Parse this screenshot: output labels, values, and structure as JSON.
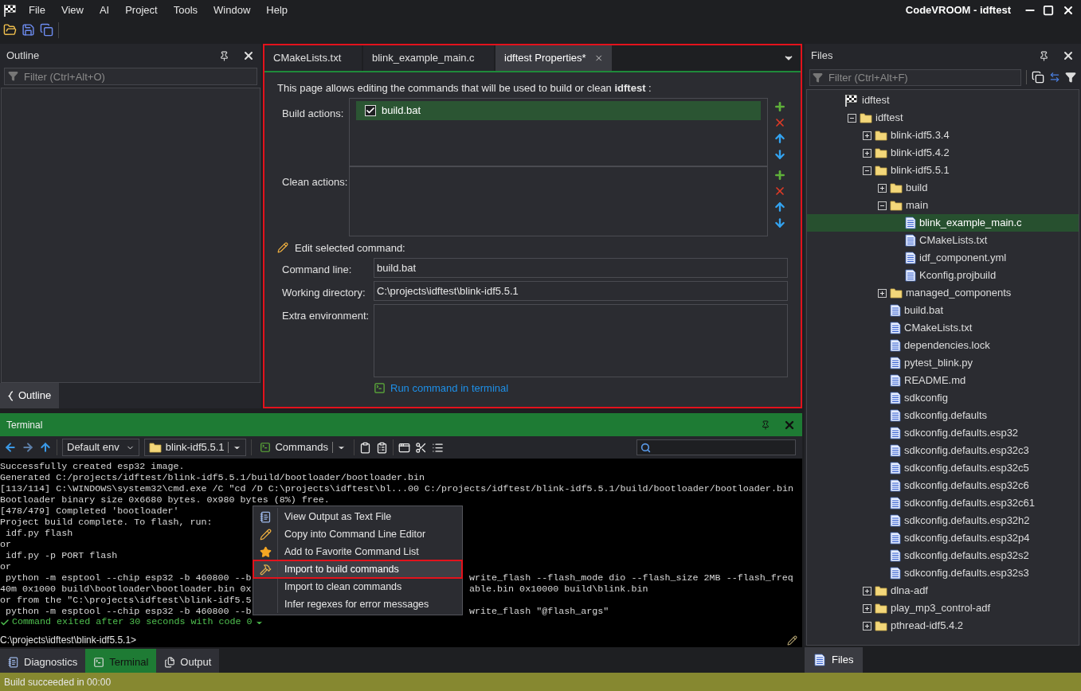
{
  "menu_bar": {
    "items": [
      "File",
      "View",
      "AI",
      "Project",
      "Tools",
      "Window",
      "Help"
    ],
    "title": "CodeVROOM - idftest"
  },
  "outline_panel": {
    "title": "Outline",
    "filter": {
      "placeholder": "Filter (Ctrl+Alt+O)"
    },
    "tabs": [
      {
        "label": "Outline",
        "selected": true
      }
    ]
  },
  "editor": {
    "tabs": [
      {
        "label": "CMakeLists.txt",
        "selected": false
      },
      {
        "label": "blink_example_main.c",
        "selected": false
      },
      {
        "label": "idftest Properties*",
        "selected": true
      }
    ],
    "intro": "This page allows editing the commands that will be used to build or clean **idftest** :",
    "build_actions": {
      "label": "Build actions:",
      "items": [
        {
          "label": "build.bat",
          "checked": true,
          "selected": true
        }
      ]
    },
    "clean_actions": {
      "label": "Clean actions:"
    },
    "edit_title": "Edit selected command:",
    "fields": [
      {
        "kind": "line",
        "label": "Command line:",
        "value": "build.bat"
      },
      {
        "kind": "line",
        "label": "Working directory:",
        "value": "C:\\projects\\idftest\\blink-idf5.5.1"
      },
      {
        "kind": "area",
        "label": "Extra environment:"
      }
    ],
    "run_link": "Run command in terminal"
  },
  "files_panel": {
    "title": "Files",
    "filter": {
      "placeholder": "Filter (Ctrl+Alt+F)"
    },
    "tree": [
      {
        "kind": "project",
        "label": "idftest",
        "selected": false,
        "children": [
          {
            "kind": "folder",
            "label": "idftest",
            "expanded": true,
            "selected": false,
            "children": [
              {
                "kind": "folder",
                "label": "blink-idf5.3.4",
                "expanded": false,
                "selected": false
              },
              {
                "kind": "folder",
                "label": "blink-idf5.4.2",
                "expanded": false,
                "selected": false
              },
              {
                "kind": "folder",
                "label": "blink-idf5.5.1",
                "expanded": true,
                "selected": false,
                "children": [
                  {
                    "kind": "folder",
                    "label": "build",
                    "expanded": false,
                    "selected": false
                  },
                  {
                    "kind": "folder",
                    "label": "main",
                    "expanded": true,
                    "selected": false,
                    "children": [
                      {
                        "kind": "file",
                        "label": "blink_example_main.c",
                        "selected": true
                      },
                      {
                        "kind": "file",
                        "label": "CMakeLists.txt",
                        "selected": false
                      },
                      {
                        "kind": "file",
                        "label": "idf_component.yml",
                        "selected": false
                      },
                      {
                        "kind": "file",
                        "label": "Kconfig.projbuild",
                        "selected": false
                      }
                    ]
                  },
                  {
                    "kind": "folder",
                    "label": "managed_components",
                    "expanded": false,
                    "selected": false
                  },
                  {
                    "kind": "file",
                    "label": "build.bat",
                    "selected": false
                  },
                  {
                    "kind": "file",
                    "label": "CMakeLists.txt",
                    "selected": false
                  },
                  {
                    "kind": "file",
                    "label": "dependencies.lock",
                    "selected": false
                  },
                  {
                    "kind": "file",
                    "label": "pytest_blink.py",
                    "selected": false
                  },
                  {
                    "kind": "file",
                    "label": "README.md",
                    "selected": false
                  },
                  {
                    "kind": "file",
                    "label": "sdkconfig",
                    "selected": false
                  },
                  {
                    "kind": "file",
                    "label": "sdkconfig.defaults",
                    "selected": false
                  },
                  {
                    "kind": "file",
                    "label": "sdkconfig.defaults.esp32",
                    "selected": false
                  },
                  {
                    "kind": "file",
                    "label": "sdkconfig.defaults.esp32c3",
                    "selected": false
                  },
                  {
                    "kind": "file",
                    "label": "sdkconfig.defaults.esp32c5",
                    "selected": false
                  },
                  {
                    "kind": "file",
                    "label": "sdkconfig.defaults.esp32c6",
                    "selected": false
                  },
                  {
                    "kind": "file",
                    "label": "sdkconfig.defaults.esp32c61",
                    "selected": false
                  },
                  {
                    "kind": "file",
                    "label": "sdkconfig.defaults.esp32h2",
                    "selected": false
                  },
                  {
                    "kind": "file",
                    "label": "sdkconfig.defaults.esp32p4",
                    "selected": false
                  },
                  {
                    "kind": "file",
                    "label": "sdkconfig.defaults.esp32s2",
                    "selected": false
                  },
                  {
                    "kind": "file",
                    "label": "sdkconfig.defaults.esp32s3",
                    "selected": false
                  }
                ]
              },
              {
                "kind": "folder",
                "label": "dlna-adf",
                "expanded": false,
                "selected": false
              },
              {
                "kind": "folder",
                "label": "play_mp3_control-adf",
                "expanded": false,
                "selected": false
              },
              {
                "kind": "folder",
                "label": "pthread-idf5.4.2",
                "expanded": false,
                "selected": false
              }
            ]
          }
        ]
      }
    ],
    "tabs": [
      {
        "label": "Files",
        "selected": true
      }
    ]
  },
  "terminal": {
    "title": "Terminal",
    "env": "Default env",
    "folder": "blink-idf5.5.1",
    "commands": "Commands",
    "lines": [
      {
        "kind": "output",
        "text": "Successfully created esp32 image."
      },
      {
        "kind": "output",
        "text": "Generated C:/projects/idftest/blink-idf5.5.1/build/bootloader/bootloader.bin"
      },
      {
        "kind": "output",
        "text": "[113/114] C:\\WINDOWS\\system32\\cmd.exe /C \"cd /D C:\\projects\\idftest\\bl...00 C:/projects/idftest/blink-idf5.5.1/build/bootloader/bootloader.bin"
      },
      {
        "kind": "output",
        "text": "Bootloader binary size 0x6680 bytes. 0x980 bytes (8%) free."
      },
      {
        "kind": "output",
        "text": "[478/479] Completed 'bootloader'"
      },
      {
        "kind": "output",
        "text": "Project build complete. To flash, run:"
      },
      {
        "kind": "output",
        "text": " idf.py flash"
      },
      {
        "kind": "output",
        "text": "or"
      },
      {
        "kind": "output",
        "text": " idf.py -p PORT flash"
      },
      {
        "kind": "output",
        "text": "or"
      },
      {
        "kind": "output",
        "text": " python -m esptool --chip esp32 -b 460800 --b",
        "right": "write_flash --flash_mode dio --flash_size 2MB --flash_freq"
      },
      {
        "kind": "output",
        "text": "40m 0x1000 build\\bootloader\\bootloader.bin 0x",
        "right": "able.bin 0x10000 build\\blink.bin"
      },
      {
        "kind": "output",
        "text": "or from the \"C:\\projects\\idftest\\blink-idf5.5"
      },
      {
        "kind": "output",
        "text": " python -m esptool --chip esp32 -b 460800 --b",
        "right": "write_flash \"@flash_args\""
      },
      {
        "kind": "success",
        "text": "Command exited after 30 seconds with code 0"
      }
    ],
    "prompt": "C:\\projects\\idftest\\blink-idf5.5.1>",
    "context_menu": [
      {
        "label": "View Output as Text File",
        "selected": false
      },
      {
        "label": "Copy into Command Line Editor",
        "selected": false
      },
      {
        "label": "Add to Favorite Command List",
        "selected": false
      },
      {
        "label": "Import to build commands",
        "selected": true
      },
      {
        "label": "Import to clean commands",
        "selected": false
      },
      {
        "label": "Infer regexes for error messages",
        "selected": false
      }
    ]
  },
  "bottom_tabs": [
    {
      "label": "Diagnostics",
      "selected": false
    },
    {
      "label": "Terminal",
      "selected": true
    },
    {
      "label": "Output",
      "selected": false
    }
  ],
  "status_bar": {
    "text": "Build succeeded in 00:00"
  }
}
